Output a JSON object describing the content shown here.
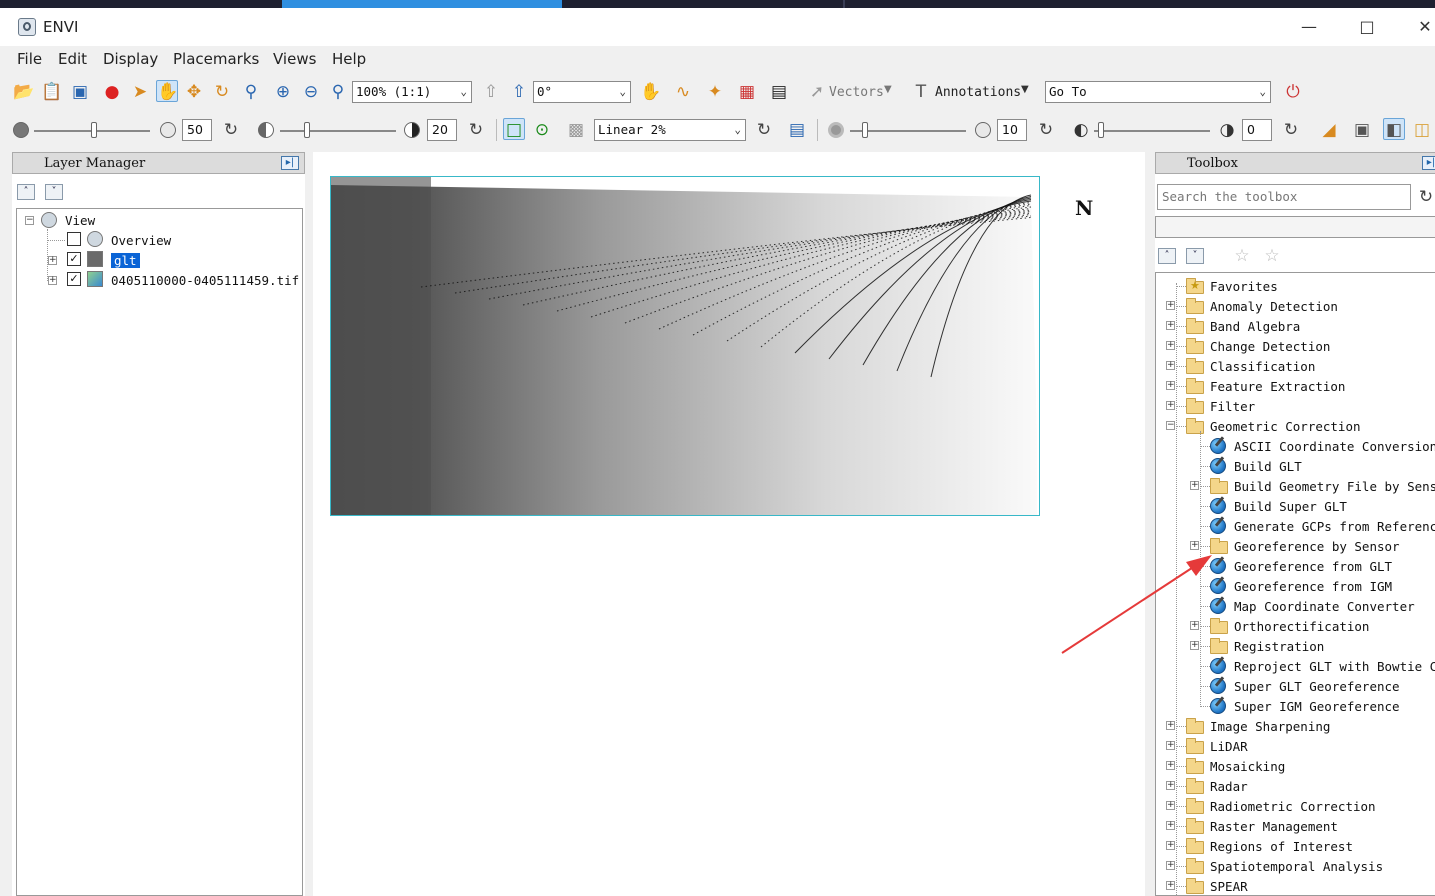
{
  "window": {
    "title": "ENVI"
  },
  "menu": [
    "File",
    "Edit",
    "Display",
    "Placemarks",
    "Views",
    "Help"
  ],
  "toolbar1": {
    "zoom_value": "100% (1:1)",
    "rotation_value": "0°",
    "vectors_label": "Vectors",
    "annotations_label": "Annotations",
    "goto_value": "Go To"
  },
  "toolbar2": {
    "brightness_value": "50",
    "contrast_value": "20",
    "stretch_value": "Linear 2%",
    "sharpen_value": "10",
    "transparency_value": "0"
  },
  "layer_manager": {
    "title": "Layer Manager",
    "root": "View",
    "items": [
      {
        "label": "Overview",
        "checked": false
      },
      {
        "label": "glt",
        "checked": true,
        "selected": true
      },
      {
        "label": "0405110000-0405111459.tif",
        "checked": true
      }
    ]
  },
  "view": {
    "north_label": "N"
  },
  "toolbox": {
    "title": "Toolbox",
    "search_placeholder": "Search the toolbox",
    "top_folders": [
      "Favorites",
      "Anomaly Detection",
      "Band Algebra",
      "Change Detection",
      "Classification",
      "Feature Extraction",
      "Filter",
      "Geometric Correction"
    ],
    "geometric_children": [
      {
        "label": "ASCII Coordinate Conversion",
        "type": "tool"
      },
      {
        "label": "Build GLT",
        "type": "tool"
      },
      {
        "label": "Build Geometry File by Sensor",
        "type": "folder"
      },
      {
        "label": "Build Super GLT",
        "type": "tool"
      },
      {
        "label": "Generate GCPs from Reference",
        "type": "tool"
      },
      {
        "label": "Georeference by Sensor",
        "type": "folder"
      },
      {
        "label": "Georeference from GLT",
        "type": "tool"
      },
      {
        "label": "Georeference from IGM",
        "type": "tool"
      },
      {
        "label": "Map Coordinate Converter",
        "type": "tool"
      },
      {
        "label": "Orthorectification",
        "type": "folder"
      },
      {
        "label": "Registration",
        "type": "folder"
      },
      {
        "label": "Reproject GLT with Bowtie Correction",
        "type": "tool"
      },
      {
        "label": "Super GLT Georeference",
        "type": "tool"
      },
      {
        "label": "Super IGM Georeference",
        "type": "tool"
      }
    ],
    "bottom_folders": [
      "Image Sharpening",
      "LiDAR",
      "Mosaicking",
      "Radar",
      "Radiometric Correction",
      "Raster Management",
      "Regions of Interest",
      "Spatiotemporal Analysis",
      "SPEAR"
    ]
  },
  "colors": {
    "selection": "#0a64d6",
    "annotation_arrow": "#e53a3a",
    "image_border": "#38b8c8"
  }
}
